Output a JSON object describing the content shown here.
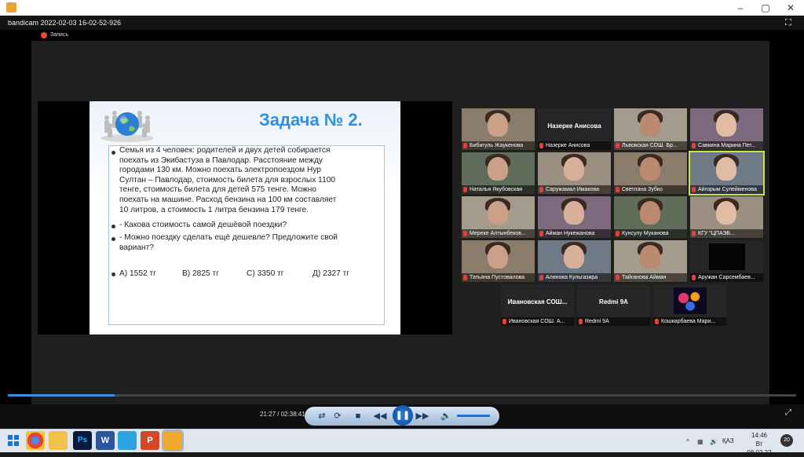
{
  "window": {
    "filename": "bandicam 2022-02-03 16-02-52-926",
    "recording_label": "Запись"
  },
  "slide": {
    "title": "Задача № 2.",
    "paragraph": [
      "Семья из 4 человек: родителей и двух детей  собирается",
      "поехать из Экибастуза в Павлодар. Расстояние между",
      "городами 130 км. Можно поехать электропоездом Нур",
      "Султан – Павлодар, стоимость билета для взрослых 1100",
      "тенге, стоимость билета для детей 575 тенге. Можно",
      "поехать на машине. Расход бензина на 100 км составляет",
      "10 литров, а стоимость 1 литра бензина 179 тенге."
    ],
    "question1": "- Какова стоимость самой дешёвой поездки?",
    "question2": [
      "- Можно поездку сделать ещё дешевле?  Предложите свой",
      "вариант?"
    ],
    "answers": [
      "А) 1552 тг",
      "В)  2825 тг",
      "С)  3350 тг",
      "Д) 2327 тг"
    ]
  },
  "participants": [
    {
      "name": "Бибигуль Жаукенова",
      "type": "video"
    },
    {
      "name": "Назерке Анисова",
      "type": "name",
      "big": "Назерке Анисова"
    },
    {
      "name": "Львовская СОШ. Бр...",
      "type": "video"
    },
    {
      "name": "Савкина Марина Пет...",
      "type": "video"
    },
    {
      "name": "Наталья Якубовская",
      "type": "video"
    },
    {
      "name": "Саружамал Имакова",
      "type": "video"
    },
    {
      "name": "Светлана Зубко",
      "type": "video"
    },
    {
      "name": "Айгорым Сулейменова",
      "type": "video",
      "active": true
    },
    {
      "name": "Мереке Алтынбеков...",
      "type": "video"
    },
    {
      "name": "Айжан Нукежанова",
      "type": "video"
    },
    {
      "name": "Кунсулу Муканова",
      "type": "video"
    },
    {
      "name": "КГУ \"ЦПАЭБ...",
      "type": "video"
    },
    {
      "name": "Татьяна Пустовалова",
      "type": "video"
    },
    {
      "name": "Алинова Кульгазира",
      "type": "video"
    },
    {
      "name": "Тайганова Айман",
      "type": "video"
    },
    {
      "name": "Аружан Сарсембаев...",
      "type": "dark"
    },
    {
      "name": "Ивановская СОШ. А...",
      "type": "name",
      "big": "Ивановская  СОШ..."
    },
    {
      "name": "Redmi 9A",
      "type": "name",
      "big": "Redmi 9A"
    },
    {
      "name": "Кошкарбаева Мари...",
      "type": "flowers"
    }
  ],
  "player": {
    "time": "21:27 / 02:38:41",
    "progress": 0.135,
    "volume": 0.7
  },
  "taskbar": {
    "time": "14:46",
    "date": "Вт 08.02.22",
    "lang": "ҚАЗ",
    "notifications": "20"
  },
  "colors": {
    "accent": "#2f8fe0",
    "mic_muted": "#e04040",
    "active_speaker": "#c8e64a"
  }
}
